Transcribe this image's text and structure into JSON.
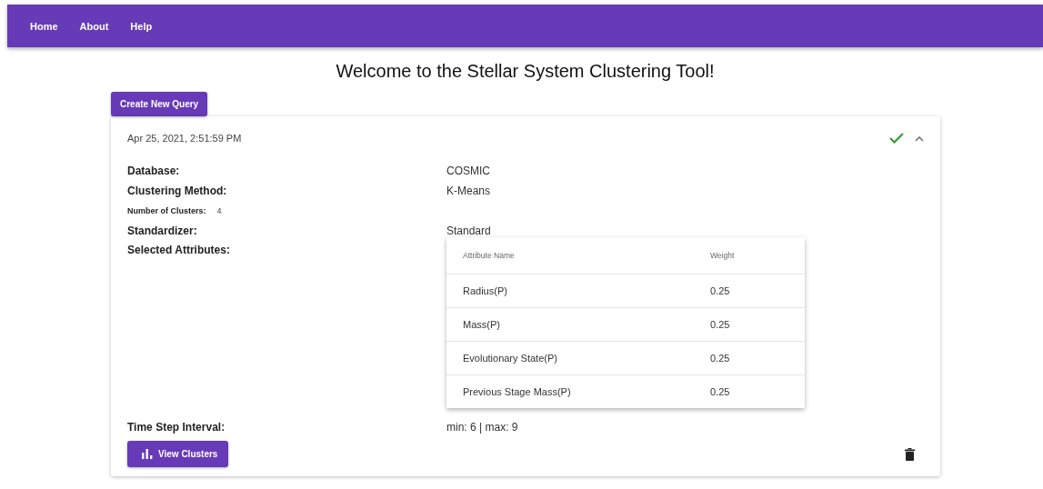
{
  "nav": [
    {
      "label": "Home"
    },
    {
      "label": "About"
    },
    {
      "label": "Help"
    }
  ],
  "title": "Welcome to the Stellar System Clustering Tool!",
  "create_button": "Create New Query",
  "query": {
    "timestamp": "Apr 25, 2021, 2:51:59 PM",
    "succeeded": true,
    "expanded": true,
    "fields": [
      {
        "kind": "main",
        "label": "Database:",
        "value": "COSMIC"
      },
      {
        "kind": "main",
        "label": "Clustering Method:",
        "value": "K-Means"
      },
      {
        "kind": "sub",
        "label": "Number of Clusters:",
        "value": "4"
      },
      {
        "kind": "main",
        "label": "Standardizer:",
        "value": "Standard"
      },
      {
        "kind": "table",
        "label": "Selected Attributes:",
        "columns": [
          "Attribute Name",
          "Weight"
        ],
        "rows": [
          [
            "Radius(P)",
            "0.25"
          ],
          [
            "Mass(P)",
            "0.25"
          ],
          [
            "Evolutionary State(P)",
            "0.25"
          ],
          [
            "Previous Stage Mass(P)",
            "0.25"
          ]
        ]
      },
      {
        "kind": "main",
        "label": "Time Step Interval:",
        "value": "min: 6 | max: 9"
      }
    ],
    "view_button": "View Clusters"
  }
}
